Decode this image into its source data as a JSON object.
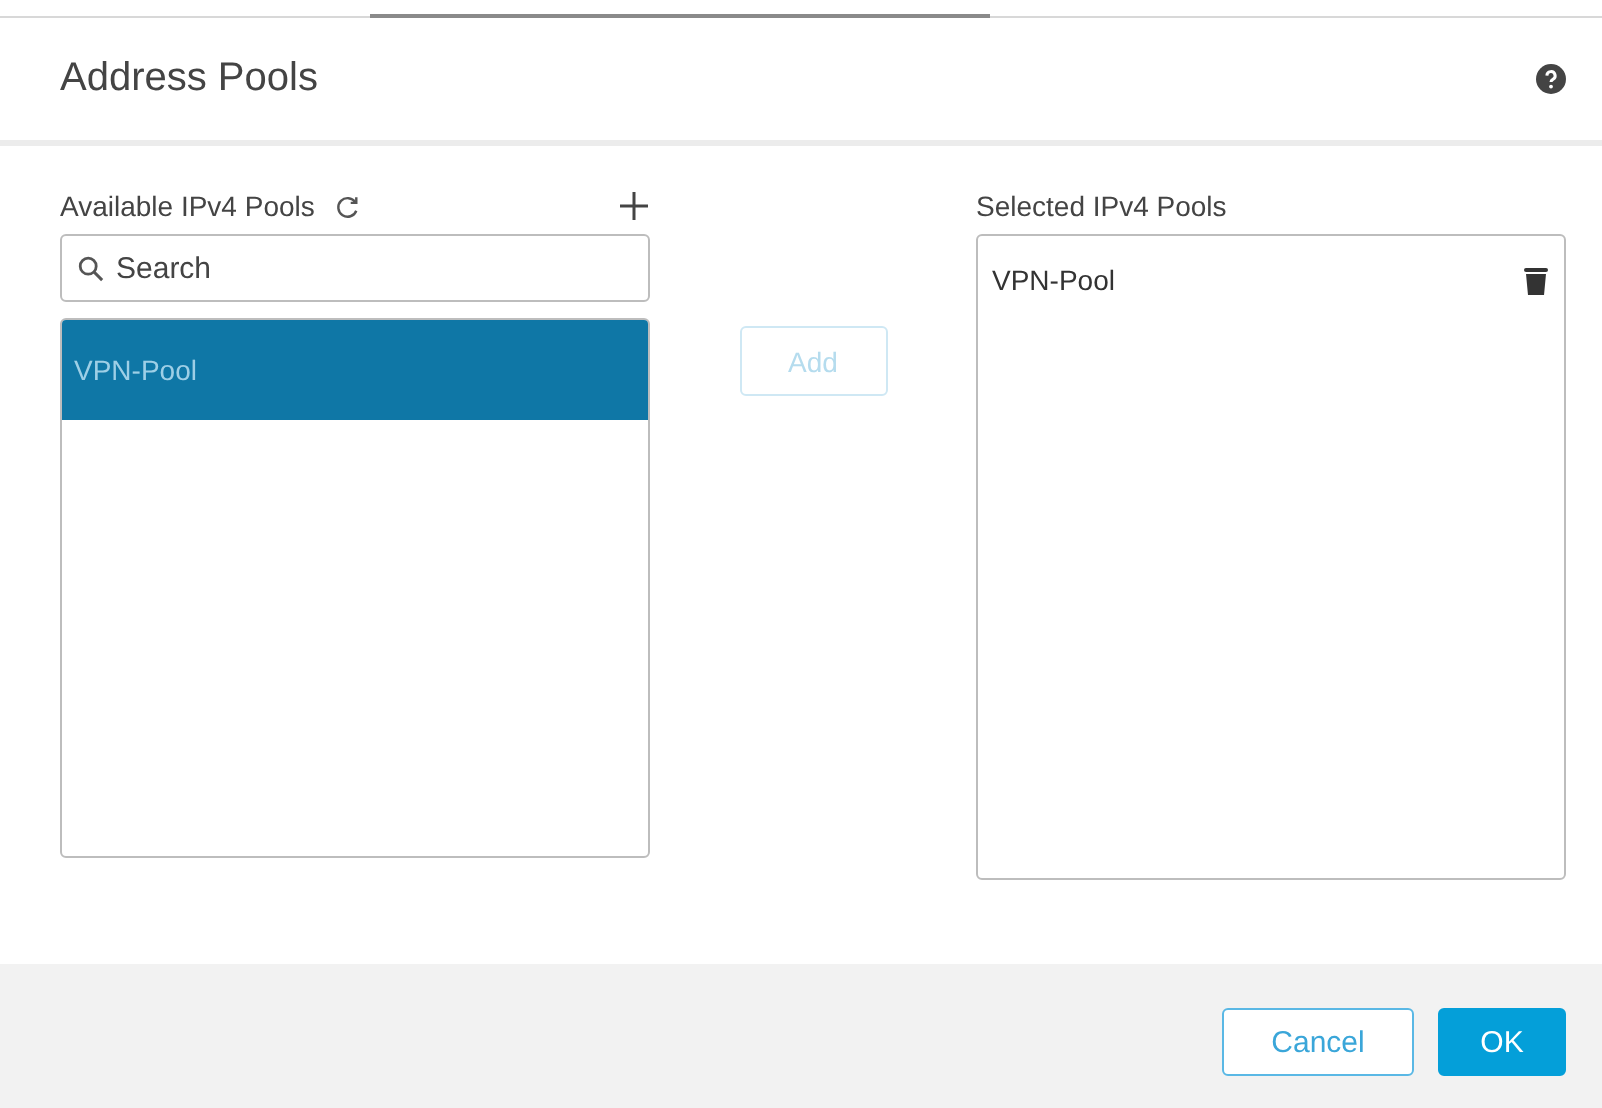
{
  "dialog": {
    "title": "Address Pools"
  },
  "available": {
    "label": "Available IPv4 Pools",
    "search": {
      "placeholder": "Search"
    },
    "items": [
      {
        "label": "VPN-Pool",
        "selected": true
      }
    ]
  },
  "add_button": {
    "label": "Add",
    "disabled": true
  },
  "selected_pools": {
    "label": "Selected IPv4 Pools",
    "items": [
      {
        "label": "VPN-Pool"
      }
    ]
  },
  "buttons": [
    {
      "label": "Cancel",
      "kind": "secondary"
    },
    {
      "label": "OK",
      "kind": "primary"
    }
  ]
}
